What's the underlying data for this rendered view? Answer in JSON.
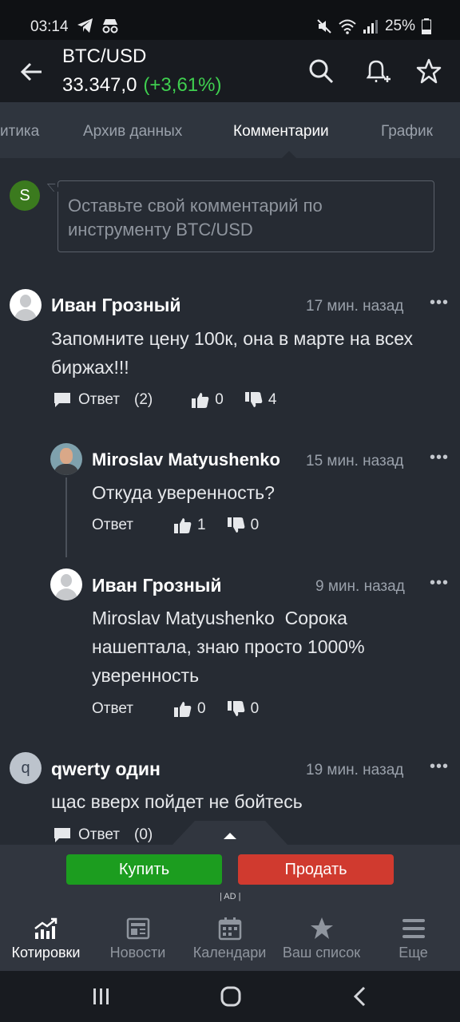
{
  "status_bar": {
    "time": "03:14",
    "battery": "25%"
  },
  "header": {
    "title": "BTC/USD",
    "price": "33.347,0",
    "change": "(+3,61%)",
    "change_color": "#3fcf4f"
  },
  "tabs": [
    "итика",
    "Архив данных",
    "Комментарии",
    "График"
  ],
  "active_tab": "Комментарии",
  "composer": {
    "avatar_letter": "S",
    "placeholder": "Оставьте свой комментарий по инструменту BTC/USD"
  },
  "comments": [
    {
      "author": "Иван Грозный",
      "time": "17 мин. назад",
      "text": "Запомните цену 100к, она в марте на всех биржах!!!",
      "reply_label": "Ответ",
      "reply_count": "(2)",
      "likes": "0",
      "dislikes": "4",
      "replies": [
        {
          "author": "Miroslav Matyushenko",
          "time": "15 мин. назад",
          "text": "Откуда уверенность?",
          "reply_label": "Ответ",
          "likes": "1",
          "dislikes": "0"
        },
        {
          "author": "Иван Грозный",
          "time": "9 мин. назад",
          "text": "Miroslav Matyushenko  Сорока нашептала, знаю просто 1000% уверенность",
          "reply_label": "Ответ",
          "likes": "0",
          "dislikes": "0"
        }
      ]
    },
    {
      "author": "qwerty один",
      "avatar_letter": "q",
      "time": "19 мин. назад",
      "text": "щас вверх пойдет не бойтесь",
      "reply_label": "Ответ",
      "reply_count": "(0)"
    }
  ],
  "more_glyph": "•••",
  "trade": {
    "buy": "Купить",
    "sell": "Продать",
    "ad": "| AD |",
    "buy_color": "#1c9d1f",
    "sell_color": "#d03a2f"
  },
  "bottom_nav": [
    {
      "label": "Котировки",
      "icon": "chart-up-icon"
    },
    {
      "label": "Новости",
      "icon": "newspaper-icon"
    },
    {
      "label": "Календари",
      "icon": "calendar-icon"
    },
    {
      "label": "Ваш список",
      "icon": "star-icon"
    },
    {
      "label": "Еще",
      "icon": "menu-icon"
    }
  ]
}
